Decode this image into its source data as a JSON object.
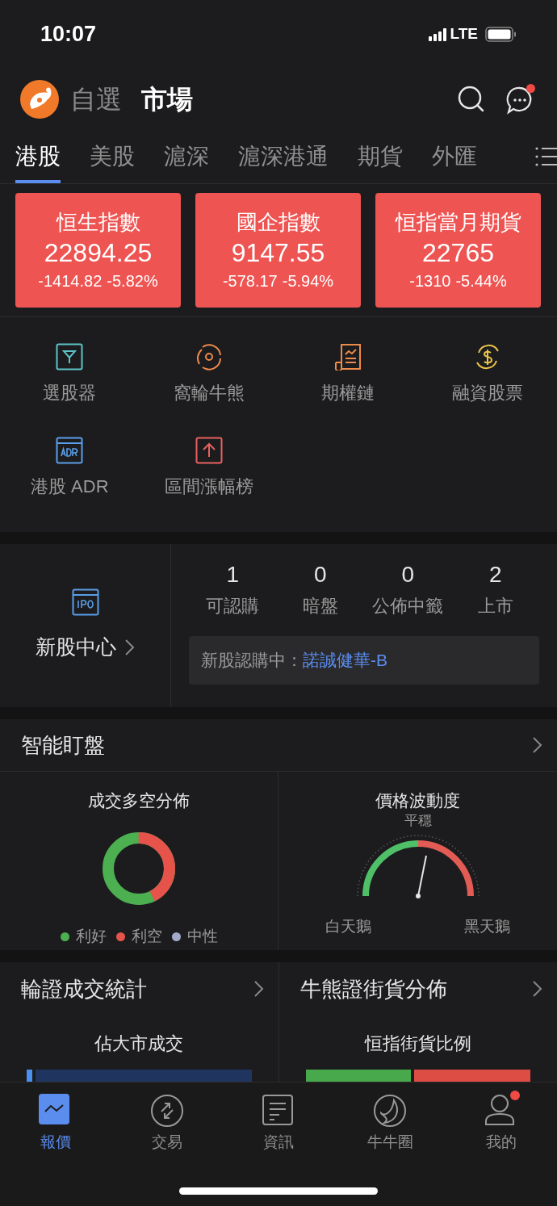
{
  "status_bar": {
    "time": "10:07",
    "network": "LTE"
  },
  "header": {
    "tabs": [
      {
        "label": "自選",
        "selected": false
      },
      {
        "label": "市場",
        "selected": true
      }
    ],
    "messages_badge": true
  },
  "market_tabs": [
    {
      "label": "港股",
      "selected": true
    },
    {
      "label": "美股",
      "selected": false
    },
    {
      "label": "滬深",
      "selected": false
    },
    {
      "label": "滬深港通",
      "selected": false
    },
    {
      "label": "期貨",
      "selected": false
    },
    {
      "label": "外匯",
      "selected": false
    }
  ],
  "indices": [
    {
      "name": "恒生指數",
      "value": "22894.25",
      "change": "-1414.82",
      "percent": "-5.82%"
    },
    {
      "name": "國企指數",
      "value": "9147.55",
      "change": "-578.17",
      "percent": "-5.94%"
    },
    {
      "name": "恒指當月期貨",
      "value": "22765",
      "change": "-1310",
      "percent": "-5.44%"
    }
  ],
  "tools": [
    {
      "label": "選股器",
      "kind": "filter"
    },
    {
      "label": "窩輪牛熊",
      "kind": "swirl"
    },
    {
      "label": "期權鏈",
      "kind": "scroll"
    },
    {
      "label": "融資股票",
      "kind": "dollar"
    },
    {
      "label": "港股 ADR",
      "kind": "adr"
    },
    {
      "label": "區間漲幅榜",
      "kind": "rise"
    }
  ],
  "ipo": {
    "title": "新股中心",
    "stats": [
      {
        "value": "1",
        "label": "可認購"
      },
      {
        "value": "0",
        "label": "暗盤"
      },
      {
        "value": "0",
        "label": "公佈中籤"
      },
      {
        "value": "2",
        "label": "上市"
      }
    ],
    "banner_label": "新股認購中：",
    "banner_link": "諾誠健華-B"
  },
  "smart_monitor": {
    "title": "智能盯盤",
    "sentiment": {
      "title": "成交多空分佈",
      "legend": [
        {
          "label": "利好",
          "color": "#4caf50"
        },
        {
          "label": "利空",
          "color": "#e5534b"
        },
        {
          "label": "中性",
          "color": "#a3abc9"
        }
      ]
    },
    "volatility": {
      "title": "價格波動度",
      "state": "平穩",
      "left_label": "白天鵝",
      "right_label": "黑天鵝"
    }
  },
  "cards": [
    {
      "title": "輪證成交統計",
      "subtitle": "佔大市成交",
      "kind": "volume"
    },
    {
      "title": "牛熊證街貨分佈",
      "subtitle": "恒指街貨比例",
      "kind": "ratio"
    }
  ],
  "bottom_nav": [
    {
      "label": "報價",
      "selected": true,
      "badge": false,
      "kind": "quote"
    },
    {
      "label": "交易",
      "selected": false,
      "badge": false,
      "kind": "trade"
    },
    {
      "label": "資訊",
      "selected": false,
      "badge": false,
      "kind": "news"
    },
    {
      "label": "牛牛圈",
      "selected": false,
      "badge": false,
      "kind": "circle"
    },
    {
      "label": "我的",
      "selected": false,
      "badge": true,
      "kind": "me"
    }
  ]
}
